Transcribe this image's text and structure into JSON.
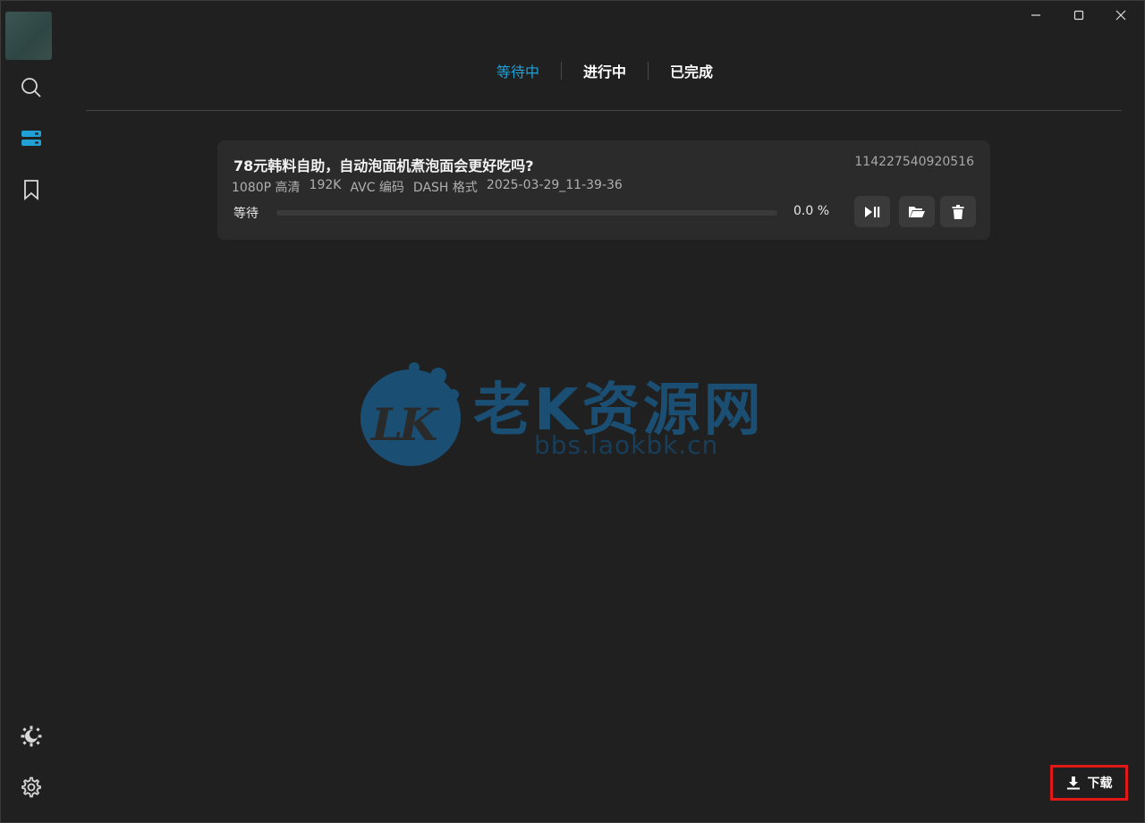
{
  "tabs": [
    {
      "label": "等待中",
      "active": true
    },
    {
      "label": "进行中",
      "active": false
    },
    {
      "label": "已完成",
      "active": false
    }
  ],
  "task": {
    "title": "78元韩料自助，自动泡面机煮泡面会更好吃吗?",
    "id": "114227540920516",
    "meta": [
      "1080P 高清",
      "192K",
      "AVC 编码",
      "DASH 格式",
      "2025-03-29_11-39-36"
    ],
    "status": "等待",
    "progress_percent": 0.0,
    "progress_text": "0.0 %"
  },
  "watermark": {
    "logo_text": "LK",
    "title": "老K资源网",
    "url": "bbs.laokbk.cn"
  },
  "download_button": {
    "label": "下载"
  },
  "icons": {
    "sidebar": [
      "search-icon",
      "download-list-icon",
      "bookmark-icon",
      "theme-icon",
      "gear-icon"
    ],
    "titlebar": [
      "minimize-icon",
      "maximize-icon",
      "close-icon"
    ],
    "card_actions": [
      "play-pause-icon",
      "folder-open-icon",
      "trash-icon"
    ]
  },
  "colors": {
    "accent": "#21a0d6",
    "background": "#202020",
    "card": "#2b2b2b",
    "highlight_border": "#e01818"
  }
}
